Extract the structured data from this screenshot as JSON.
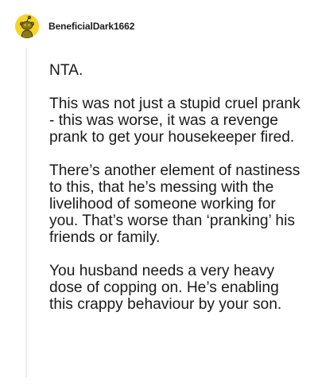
{
  "comment": {
    "username": "BeneficialDark1662",
    "avatar_icon": "snoo-avatar-icon",
    "avatar_color": "#f5d327",
    "paragraphs": [
      "NTA.",
      "This was not just a stupid cruel prank - this was worse, it was a revenge prank to get your housekeeper fired.",
      "There’s another element of nastiness to this, that he’s messing with the livelihood of someone working for you. That’s worse than ‘pranking’ his friends or family.",
      "You husband needs a very heavy dose of copping on. He’s enabling this crappy behaviour by your son."
    ]
  }
}
